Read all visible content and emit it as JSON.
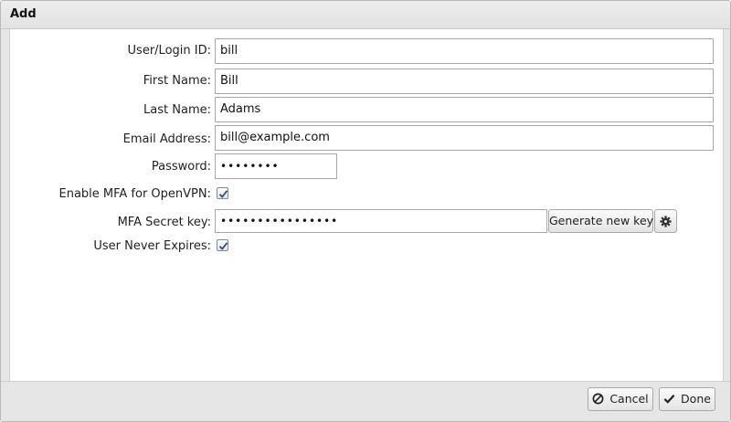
{
  "dialog": {
    "title": "Add"
  },
  "form": {
    "user_login_label": "User/Login ID:",
    "user_login_value": "bill",
    "first_name_label": "First Name:",
    "first_name_value": "Bill",
    "last_name_label": "Last Name:",
    "last_name_value": "Adams",
    "email_label": "Email Address:",
    "email_value": "bill@example.com",
    "password_label": "Password:",
    "password_value": "••••••••",
    "mfa_enable_label": "Enable MFA for OpenVPN:",
    "mfa_enable_checked": true,
    "mfa_secret_label": "MFA Secret key:",
    "mfa_secret_value": "••••••••••••••••",
    "generate_key_label": "Generate new key",
    "settings_icon": "gear-icon",
    "never_expires_label": "User Never Expires:",
    "never_expires_checked": true
  },
  "footer": {
    "cancel_label": "Cancel",
    "cancel_icon": "cancel-circle-icon",
    "done_label": "Done",
    "done_icon": "checkmark-icon"
  },
  "colors": {
    "checkmark": "#3b4a7a",
    "panel_bg": "#e6e6e6",
    "content_bg": "#ffffff"
  }
}
